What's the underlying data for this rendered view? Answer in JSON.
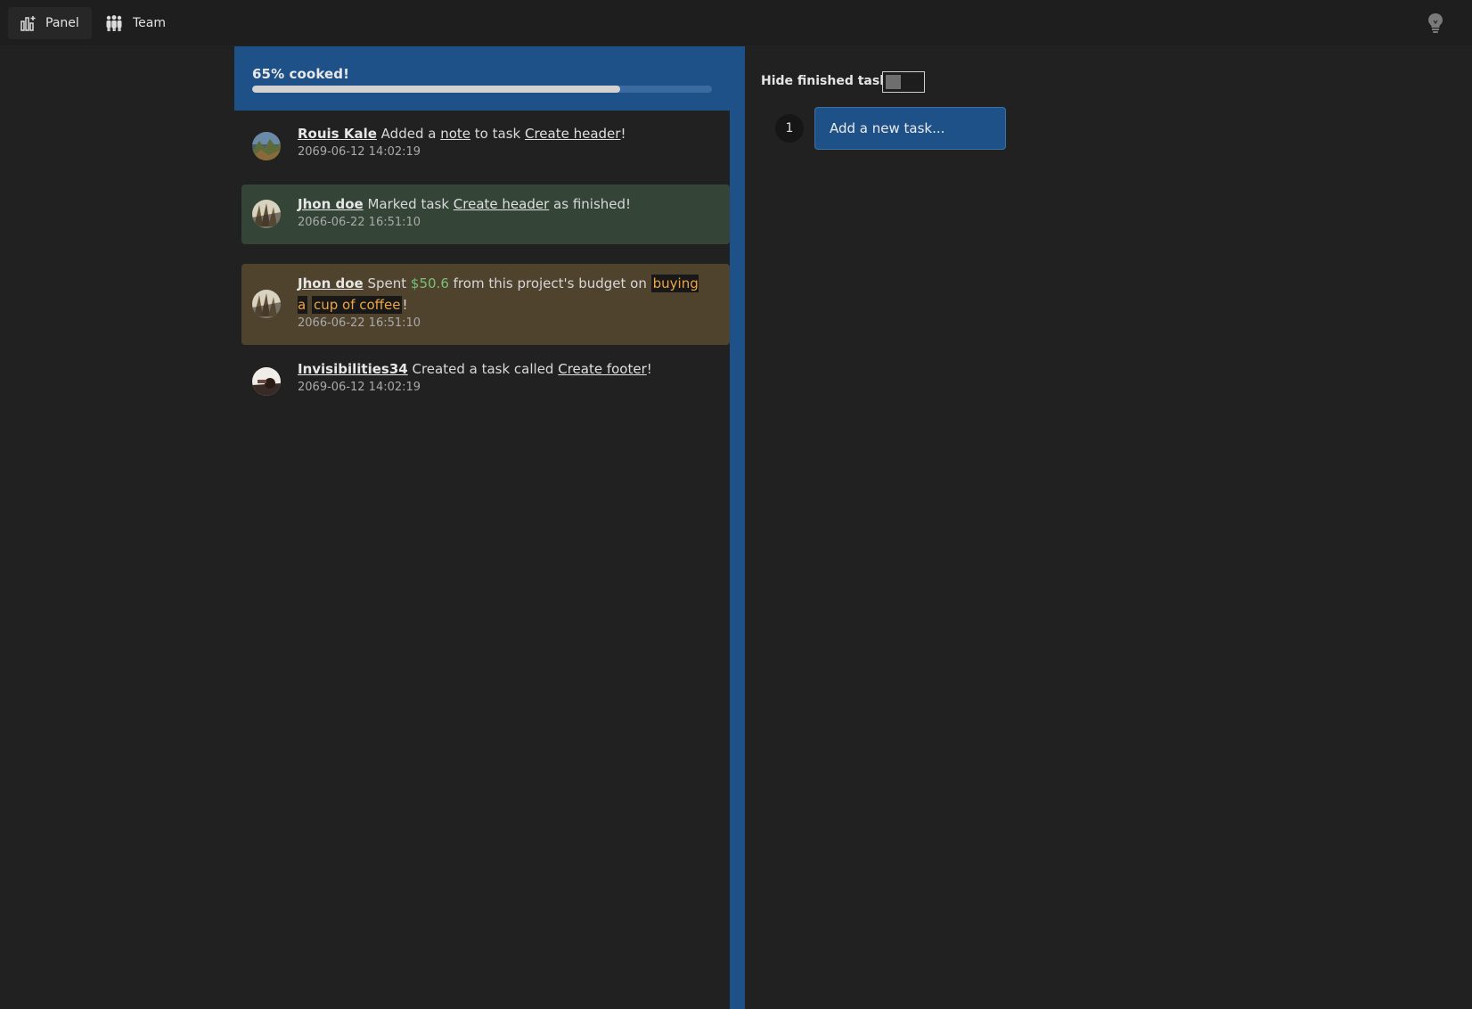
{
  "nav": {
    "panel_label": "Panel",
    "team_label": "Team"
  },
  "progress": {
    "label": "65% cooked!",
    "value_percent": 80
  },
  "activities": [
    {
      "user": "Rouis Kale",
      "parts": [
        "Added a",
        "note",
        "to task",
        "Create header",
        "!"
      ],
      "time": "2069-06-12 14:02:19"
    },
    {
      "user": "Jhon doe",
      "parts": [
        "Marked task",
        "Create header",
        "as finished!"
      ],
      "time": "2066-06-22 16:51:10"
    },
    {
      "user": "Jhon doe",
      "parts": [
        "Spent",
        "$50.6",
        "from this project's budget on",
        "buying a",
        "cup of coffee",
        "!"
      ],
      "time": "2066-06-22 16:51:10"
    },
    {
      "user": "Invisibilities34",
      "parts": [
        "Created a task called",
        "Create footer",
        "!"
      ],
      "time": "2069-06-12 14:02:19"
    }
  ],
  "tasks": {
    "hide_finished_label": "Hide finished tasks",
    "hide_finished_on": false,
    "task_number": "1",
    "add_task_label": "Add a new task..."
  },
  "colors": {
    "background": "#212121",
    "accent_blue": "#1f5189",
    "finished_green": "#344538",
    "budget_brown": "#4f432e",
    "money_green": "#78c078",
    "highlight_orange": "#f0a540"
  },
  "icons": {
    "panel": "chart-plus-icon",
    "team": "team-icon",
    "theme": "lightbulb-icon"
  }
}
